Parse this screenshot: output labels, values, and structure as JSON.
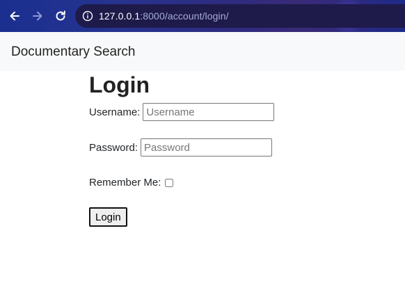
{
  "browser": {
    "url_host": "127.0.0.1",
    "url_path": ":8000/account/login/",
    "icons": [
      "back-arrow-icon",
      "forward-arrow-icon",
      "reload-icon",
      "info-icon"
    ]
  },
  "navbar": {
    "brand": "Documentary Search"
  },
  "login": {
    "title": "Login",
    "username_label": "Username:",
    "username_placeholder": "Username",
    "password_label": "Password:",
    "password_placeholder": "Password",
    "remember_label": "Remember Me:",
    "remember_checked": false,
    "submit_label": "Login"
  }
}
